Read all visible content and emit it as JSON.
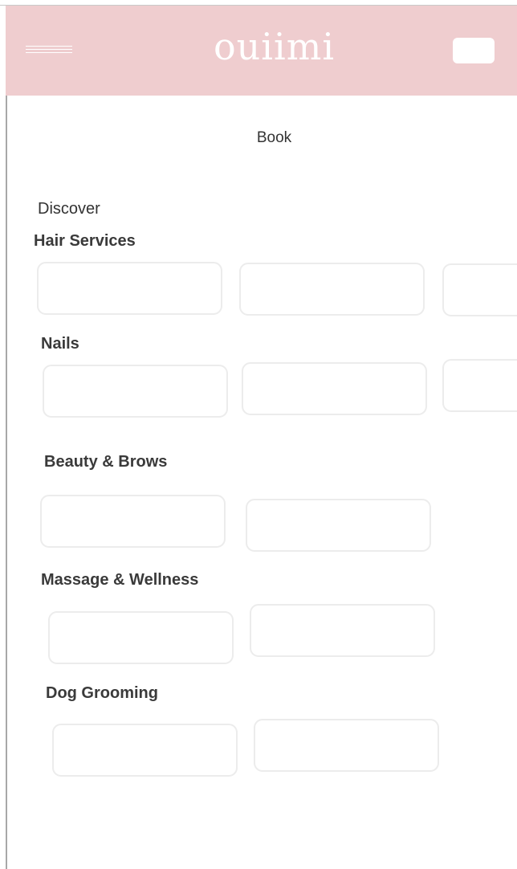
{
  "header": {
    "brand": "ouiimi",
    "background_color": "#efcdcf",
    "menu_icon": "hamburger-menu-icon"
  },
  "nav": {
    "book_label": "Book"
  },
  "discover": {
    "label": "Discover"
  },
  "sections": {
    "hair": {
      "title": "Hair Services",
      "card_count": 3
    },
    "nails": {
      "title": "Nails",
      "card_count": 3
    },
    "beauty": {
      "title": "Beauty & Brows",
      "card_count": 2
    },
    "massage": {
      "title": "Massage & Wellness",
      "card_count": 2
    },
    "dog": {
      "title": "Dog Grooming",
      "card_count": 2
    }
  }
}
